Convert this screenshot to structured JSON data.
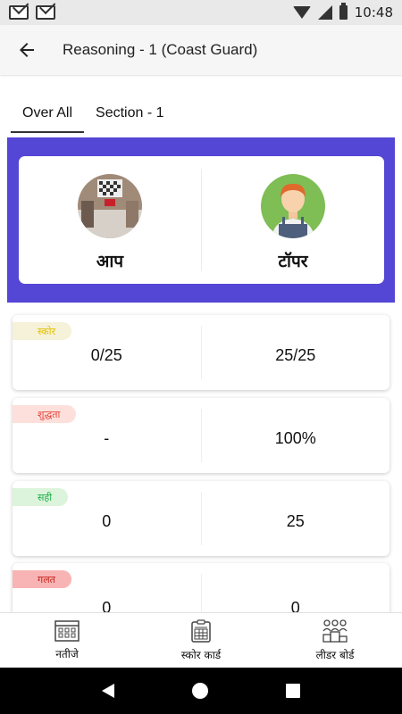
{
  "status_bar": {
    "time": "10:48"
  },
  "app_bar": {
    "title": "Reasoning - 1 (Coast Guard)"
  },
  "tabs": [
    {
      "label": "Over All",
      "active": true
    },
    {
      "label": "Section - 1",
      "active": false
    }
  ],
  "compare": {
    "you_label": "आप",
    "topper_label": "टॉपर"
  },
  "stats": [
    {
      "label": "स्कोर",
      "you": "0/25",
      "topper": "25/25",
      "pill_bg": "#f6f1d9",
      "pill_color": "#e1c200"
    },
    {
      "label": "शुद्धता",
      "you": "-",
      "topper": "100%",
      "pill_bg": "#fde0dc",
      "pill_color": "#e4463a"
    },
    {
      "label": "सही",
      "you": "0",
      "topper": "25",
      "pill_bg": "#dcf4dc",
      "pill_color": "#22b14c"
    },
    {
      "label": "गलत",
      "you": "0",
      "topper": "0",
      "pill_bg": "#f8b4b4",
      "pill_color": "#c8231b"
    }
  ],
  "bottom_nav": [
    {
      "label": "नतीजे",
      "icon": "results-grid-icon"
    },
    {
      "label": "स्कोर कार्ड",
      "icon": "scorecard-icon"
    },
    {
      "label": "लीडर बोर्ड",
      "icon": "leaderboard-icon"
    }
  ],
  "colors": {
    "accent_panel": "#5547d6"
  }
}
